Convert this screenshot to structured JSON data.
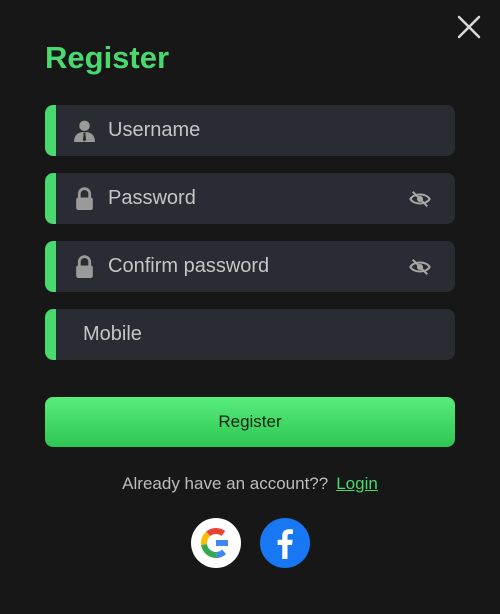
{
  "dialog": {
    "title": "Register",
    "close_icon": "close-icon"
  },
  "fields": {
    "username": {
      "placeholder": "Username",
      "value": "",
      "icon": "user-icon"
    },
    "password": {
      "placeholder": "Password",
      "value": "",
      "icon": "lock-icon",
      "toggle_icon": "eye-slash-icon"
    },
    "confirm_password": {
      "placeholder": "Confirm password",
      "value": "",
      "icon": "lock-icon",
      "toggle_icon": "eye-slash-icon"
    },
    "mobile": {
      "placeholder": "Mobile",
      "value": ""
    }
  },
  "register_button": {
    "label": "Register"
  },
  "login_prompt": {
    "text": "Already have an account??",
    "link": "Login"
  },
  "social": [
    {
      "icon": "google-icon"
    },
    {
      "icon": "facebook-icon"
    }
  ],
  "colors": {
    "accent": "#4ad96f",
    "background": "#171717",
    "field_background": "#2a2c33",
    "facebook": "#1877f2"
  }
}
